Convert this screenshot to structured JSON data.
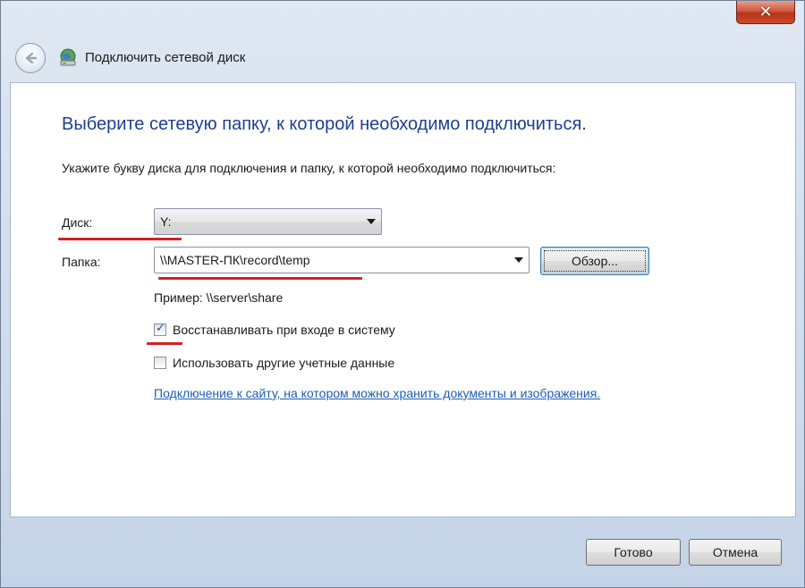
{
  "window": {
    "title": "Подключить сетевой диск",
    "close_glyph": "✕"
  },
  "main": {
    "heading": "Выберите сетевую папку, к которой необходимо подключиться.",
    "instruction": "Укажите букву диска для подключения и папку, к которой необходимо подключиться:",
    "drive_label": "Диск:",
    "drive_value": "Y:",
    "folder_label": "Папка:",
    "folder_value": "\\\\MASTER-ПК\\record\\temp",
    "browse_button": "Обзор...",
    "example_text": "Пример: \\\\server\\share",
    "reconnect_label": "Восстанавливать при входе в систему",
    "reconnect_checked": true,
    "other_credentials_label": "Использовать другие учетные данные",
    "other_credentials_checked": false,
    "link_text": "Подключение к сайту, на котором можно хранить документы и изображения."
  },
  "footer": {
    "finish_button": "Готово",
    "cancel_button": "Отмена"
  },
  "colors": {
    "heading": "#1e3f8f",
    "link": "#1c5eb6",
    "annotation_red": "#d51f1f"
  },
  "icons": {
    "back": "back-arrow-icon",
    "network_drive": "network-drive-icon",
    "dropdown": "chevron-down-icon",
    "checkmark": "checkmark-icon"
  }
}
